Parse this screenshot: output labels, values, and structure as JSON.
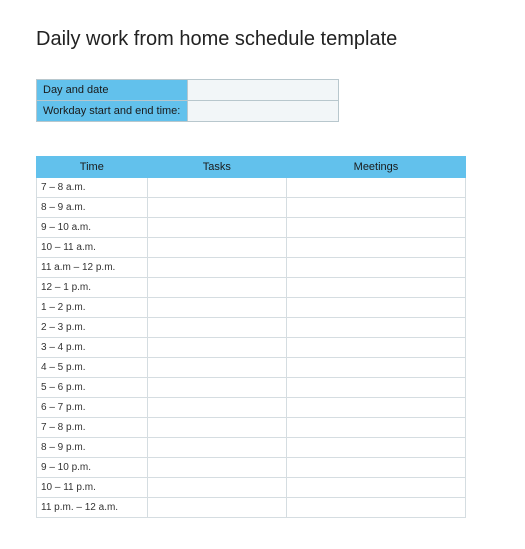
{
  "title": "Daily work from home schedule template",
  "meta": {
    "rows": [
      {
        "label": "Day and date",
        "value": ""
      },
      {
        "label": "Workday start and end time:",
        "value": ""
      }
    ]
  },
  "schedule": {
    "headers": {
      "time": "Time",
      "tasks": "Tasks",
      "meetings": "Meetings"
    },
    "rows": [
      {
        "time": "7 – 8 a.m.",
        "tasks": "",
        "meetings": ""
      },
      {
        "time": "8 – 9 a.m.",
        "tasks": "",
        "meetings": ""
      },
      {
        "time": "9 – 10 a.m.",
        "tasks": "",
        "meetings": ""
      },
      {
        "time": "10 – 11 a.m.",
        "tasks": "",
        "meetings": ""
      },
      {
        "time": "11 a.m – 12 p.m.",
        "tasks": "",
        "meetings": ""
      },
      {
        "time": "12 – 1 p.m.",
        "tasks": "",
        "meetings": ""
      },
      {
        "time": "1 – 2 p.m.",
        "tasks": "",
        "meetings": ""
      },
      {
        "time": "2 – 3 p.m.",
        "tasks": "",
        "meetings": ""
      },
      {
        "time": "3 – 4 p.m.",
        "tasks": "",
        "meetings": ""
      },
      {
        "time": "4 – 5 p.m.",
        "tasks": "",
        "meetings": ""
      },
      {
        "time": "5 – 6 p.m.",
        "tasks": "",
        "meetings": ""
      },
      {
        "time": "6 – 7 p.m.",
        "tasks": "",
        "meetings": ""
      },
      {
        "time": "7 – 8 p.m.",
        "tasks": "",
        "meetings": ""
      },
      {
        "time": "8 – 9 p.m.",
        "tasks": "",
        "meetings": ""
      },
      {
        "time": "9 – 10 p.m.",
        "tasks": "",
        "meetings": ""
      },
      {
        "time": "10 – 11 p.m.",
        "tasks": "",
        "meetings": ""
      },
      {
        "time": "11 p.m. – 12 a.m.",
        "tasks": "",
        "meetings": ""
      }
    ]
  }
}
